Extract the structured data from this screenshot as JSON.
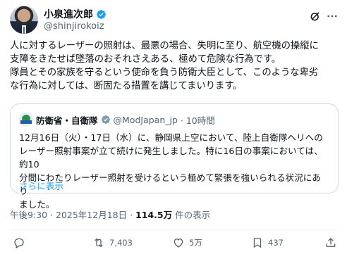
{
  "author": {
    "name": "小泉進次郎",
    "handle": "@shinjirokoiz"
  },
  "tweet": {
    "text": "人に対するレーザーの照射は、最悪の場合、失明に至り、航空機の操縦に\n支障をきたせば墜落のおそれさえある、極めて危険な行為です。\n隊員とその家族を守るという使命を負う防衛大臣として、このような卑劣\nな行為に対しては、断固たる措置を講じてまいります。"
  },
  "quote": {
    "name": "防衛省・自衛隊",
    "handle": "@ModJapan_jp",
    "time": "· 10時間",
    "text": "12月16日（火）・17日（水）に、静岡県上空において、陸上自衛隊ヘリへの\nレーザー照射事案が立て続けに発生しました。特に16日の事案においては、約10\n分間にわたりレーザー照射を受けるという極めて緊張を強いられる状況にあり\nました。",
    "show_more": "さらに表示"
  },
  "meta": {
    "time": "午後9:30 · 2025年12月18日 · ",
    "views": "114.5万",
    "views_suffix": " 件の表示"
  },
  "actions": {
    "replies": "",
    "reposts": "7,403",
    "likes": "5万",
    "bookmarks": "437"
  },
  "colors": {
    "accent": "#1d9bf0",
    "verified": "#1d9bf0",
    "secondary_text": "#536471",
    "border": "#cfd9de"
  },
  "icons": [
    "verified-badge-icon",
    "grok-icon",
    "more-icon",
    "reply-icon",
    "repost-icon",
    "like-icon",
    "bookmark-icon",
    "share-icon"
  ]
}
